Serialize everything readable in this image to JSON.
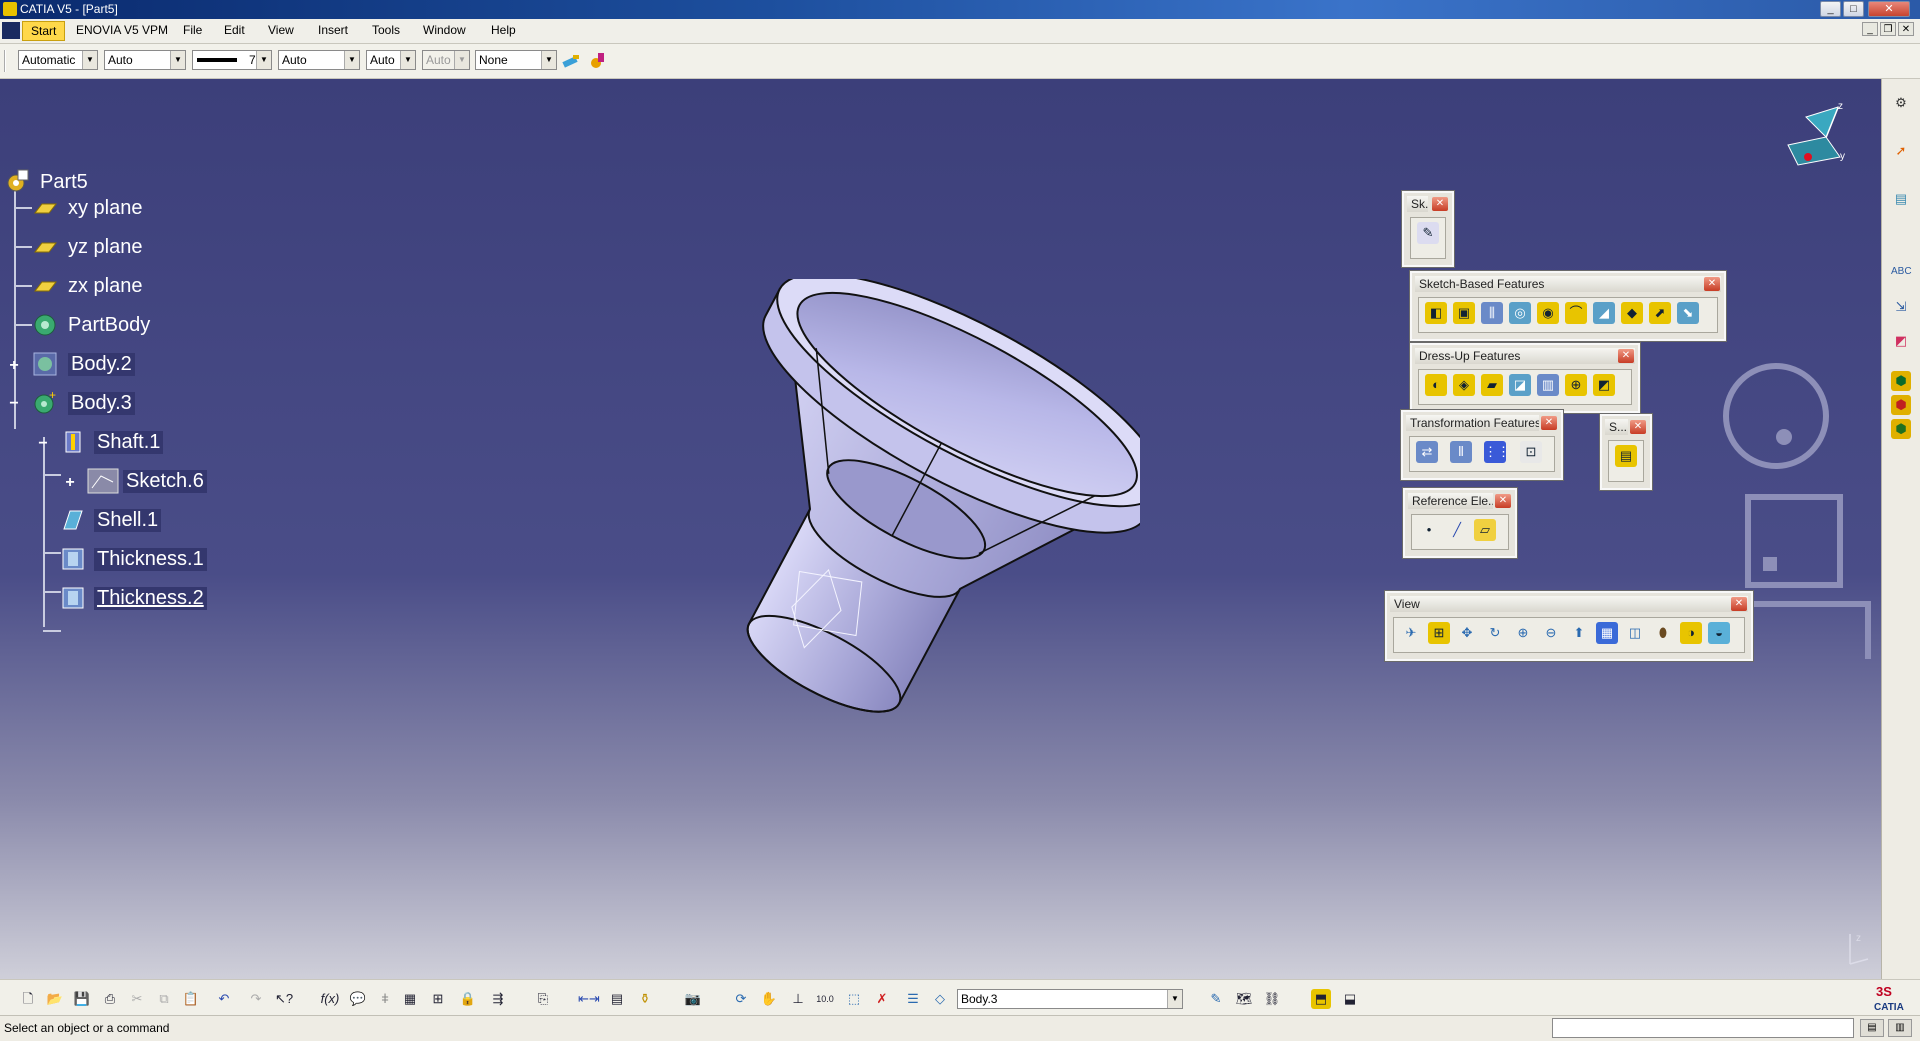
{
  "window": {
    "title": "CATIA V5 - [Part5]",
    "controls": {
      "minimize": "_",
      "maximize": "□",
      "close": "✕"
    },
    "mdi_controls": {
      "minimize": "_",
      "restore": "❐",
      "close": "✕"
    }
  },
  "menubar": {
    "items": [
      "Start",
      "ENOVIA V5 VPM",
      "File",
      "Edit",
      "View",
      "Insert",
      "Tools",
      "Window",
      "Help"
    ]
  },
  "properties_toolbar": {
    "color": "Automatic",
    "transparency": "Auto",
    "line_weight": "7",
    "line_type": "Auto",
    "point_type": "Auto",
    "layer_disabled": "Auto",
    "layer": "None"
  },
  "tree": {
    "root": "Part5",
    "nodes": [
      "xy plane",
      "yz plane",
      "zx plane",
      "PartBody",
      "Body.2",
      "Body.3",
      "Shaft.1",
      "Sketch.6",
      "Shell.1",
      "Thickness.1",
      "Thickness.2"
    ]
  },
  "toolbars": {
    "sketcher": {
      "title": "Sk..."
    },
    "sketch_based": {
      "title": "Sketch-Based Features"
    },
    "dress_up": {
      "title": "Dress-Up Features"
    },
    "transformation": {
      "title": "Transformation Features"
    },
    "surface": {
      "title": "S..."
    },
    "reference": {
      "title": "Reference Ele..."
    },
    "view": {
      "title": "View"
    }
  },
  "bottom_toolbar": {
    "current_body": "Body.3"
  },
  "status": {
    "message": "Select an object or a command",
    "command_input": ""
  },
  "colors": {
    "viewport_top": "#3c3f7a",
    "viewport_bottom": "#cfcfd9",
    "part_face": "#c7c6ee",
    "start_menu": "#ffd84a"
  }
}
